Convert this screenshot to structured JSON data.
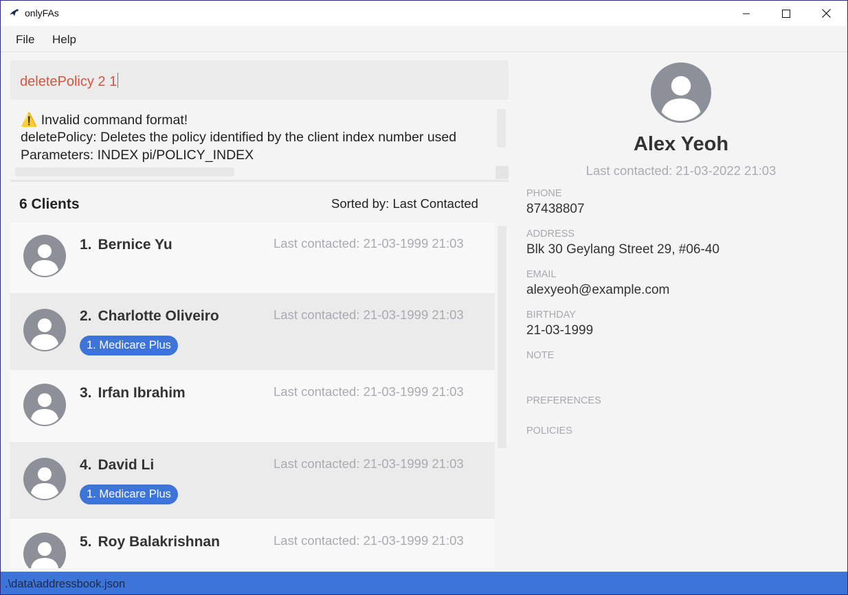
{
  "window": {
    "title": "onlyFAs"
  },
  "menu": {
    "items": [
      "File",
      "Help"
    ]
  },
  "command": {
    "value": "deletePolicy 2 1"
  },
  "result": {
    "warning_icon": "warning-icon",
    "lines": [
      "⚠️ Invalid command format!",
      "deletePolicy: Deletes the policy identified by the client index number used",
      "Parameters: INDEX pi/POLICY_INDEX"
    ]
  },
  "list": {
    "count": "6 Clients",
    "sorted_by": "Sorted by: Last Contacted",
    "clients": [
      {
        "index": "1.",
        "name": "Bernice Yu",
        "last_contacted": "Last contacted: 21-03-1999 21:03",
        "tags": []
      },
      {
        "index": "2.",
        "name": "Charlotte Oliveiro",
        "last_contacted": "Last contacted: 21-03-1999 21:03",
        "tags": [
          "1. Medicare Plus"
        ]
      },
      {
        "index": "3.",
        "name": "Irfan Ibrahim",
        "last_contacted": "Last contacted: 21-03-1999 21:03",
        "tags": []
      },
      {
        "index": "4.",
        "name": "David Li",
        "last_contacted": "Last contacted: 21-03-1999 21:03",
        "tags": [
          "1. Medicare Plus"
        ]
      },
      {
        "index": "5.",
        "name": "Roy Balakrishnan",
        "last_contacted": "Last contacted: 21-03-1999 21:03",
        "tags": []
      }
    ]
  },
  "detail": {
    "name": "Alex Yeoh",
    "last_contacted": "Last contacted: 21-03-2022 21:03",
    "phone_label": "PHONE",
    "phone": "87438807",
    "address_label": "ADDRESS",
    "address": "Blk 30 Geylang Street 29, #06-40",
    "email_label": "EMAIL",
    "email": "alexyeoh@example.com",
    "birthday_label": "BIRTHDAY",
    "birthday": "21-03-1999",
    "note_label": "NOTE",
    "preferences_label": "PREFERENCES",
    "policies_label": "POLICIES"
  },
  "status": {
    "path": ".\\data\\addressbook.json"
  },
  "colors": {
    "accent": "#3d74d9",
    "command_text": "#d8543c",
    "muted": "#aaaab2"
  }
}
